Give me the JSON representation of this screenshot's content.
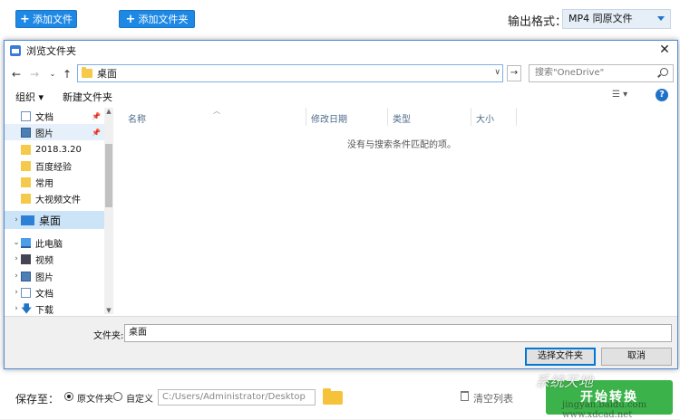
{
  "app": {
    "add_file_label": "添加文件",
    "add_folder_label": "添加文件夹",
    "output_format_label": "输出格式：",
    "output_format_value": "MP4  同原文件",
    "save_to_label": "保存至：",
    "radio_original_label": "原文件夹",
    "radio_custom_label": "自定义",
    "save_path": "C:/Users/Administrator/Desktop",
    "clear_list_label": "清空列表",
    "convert_label": "开始转换"
  },
  "dialog": {
    "title": "浏览文件夹",
    "close_glyph": "✕",
    "address": "桌面",
    "search_placeholder": "搜索\"OneDrive\"",
    "toolbar": {
      "organize": "组织 ▾",
      "new_folder": "新建文件夹"
    },
    "nav_items": [
      {
        "label": "文档",
        "icon": "document-icon",
        "pinned": true
      },
      {
        "label": "图片",
        "icon": "pictures-icon",
        "pinned": true
      },
      {
        "label": "2018.3.20",
        "icon": "folder-icon"
      },
      {
        "label": "百度经验",
        "icon": "folder-icon"
      },
      {
        "label": "常用",
        "icon": "folder-icon"
      },
      {
        "label": "大视频文件",
        "icon": "folder-icon"
      },
      {
        "label": "桌面",
        "icon": "desktop-icon",
        "selected": true
      },
      {
        "label": "此电脑",
        "icon": "computer-icon"
      },
      {
        "label": "视频",
        "icon": "video-icon"
      },
      {
        "label": "图片",
        "icon": "pictures-icon"
      },
      {
        "label": "文档",
        "icon": "document-icon"
      },
      {
        "label": "下载",
        "icon": "download-icon"
      }
    ],
    "columns": [
      "名称",
      "修改日期",
      "类型",
      "大小"
    ],
    "empty_message": "没有与搜索条件匹配的项。",
    "folder_label": "文件夹:",
    "folder_value": "桌面",
    "select_button": "选择文件夹",
    "cancel_button": "取消"
  },
  "watermark": {
    "text": "系统天地",
    "sub": "jingyan.baidu.com   www.xdcad.net"
  },
  "colors": {
    "accent": "#1e88e5",
    "convert_green": "#3cb34a",
    "selection": "#cce4f7"
  }
}
